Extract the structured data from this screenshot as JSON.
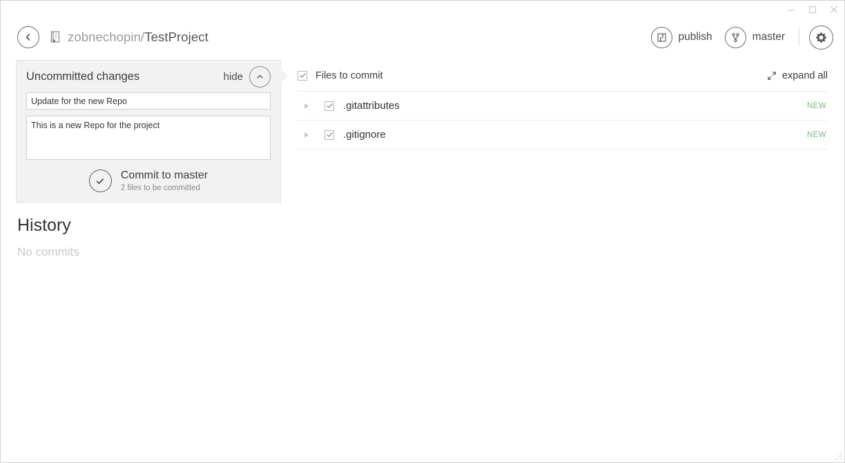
{
  "window": {
    "minimize_label": "minimize-icon",
    "maximize_label": "maximize-icon",
    "close_label": "close-icon"
  },
  "header": {
    "back_label": "back-arrow-icon",
    "repo_icon": "repo-book-icon",
    "owner": "zobnechopin/",
    "project": "TestProject",
    "publish_label": "publish",
    "publish_icon": "publish-icon",
    "branch_label": "master",
    "branch_icon": "branch-icon",
    "settings_icon": "gear-icon"
  },
  "uncommitted": {
    "title": "Uncommitted changes",
    "hide_label": "hide",
    "toggle_icon": "chevron-up-icon",
    "summary_value": "Update for the new Repo",
    "summary_placeholder": "Summary",
    "description_value": "This is a new Repo for the project",
    "description_placeholder": "Description",
    "commit_icon": "check-circle-icon",
    "commit_label": "Commit to master",
    "commit_sub": "2 files to be committed"
  },
  "history": {
    "title": "History",
    "empty_text": "No commits"
  },
  "files": {
    "header_label": "Files to commit",
    "header_checked": true,
    "expand_all_label": "expand all",
    "expand_all_icon": "expand-diagonal-icon",
    "rows": [
      {
        "name": ".gitattributes",
        "status": "NEW",
        "checked": true,
        "disclosure": "triangle-right-icon"
      },
      {
        "name": ".gitignore",
        "status": "NEW",
        "checked": true,
        "disclosure": "triangle-right-icon"
      }
    ]
  },
  "colors": {
    "panel_bg": "#f2f2f2",
    "new_badge": "#7cb77c",
    "muted_text": "#9b9b9b",
    "body_text": "#333333"
  }
}
